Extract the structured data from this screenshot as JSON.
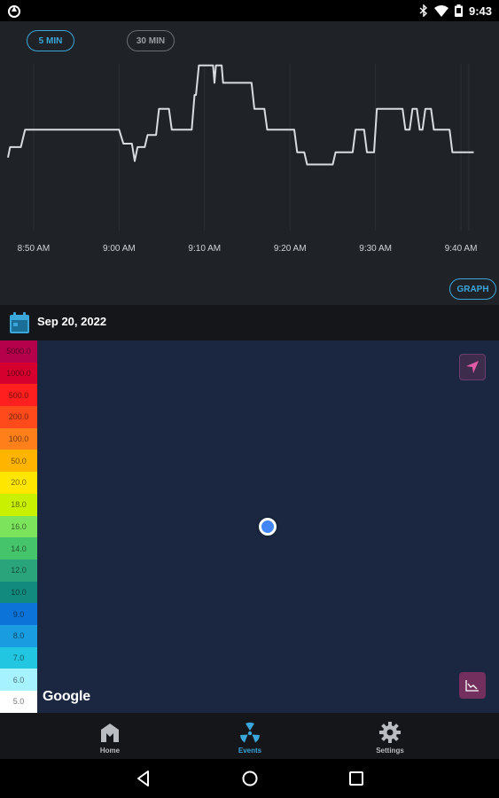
{
  "status_bar": {
    "time": "9:43"
  },
  "graph": {
    "range_buttons": [
      "5 MIN",
      "30 MIN"
    ],
    "graph_button": "GRAPH",
    "colors": {
      "active": "#3aa6d9",
      "line": "#d9dcdf",
      "grid": "#2c3036"
    }
  },
  "chart_data": {
    "type": "line",
    "x_ticks": [
      "8:50 AM",
      "9:00 AM",
      "9:10 AM",
      "9:20 AM",
      "9:30 AM",
      "9:40 AM"
    ],
    "x_range": [
      "8:47 AM",
      "9:43 AM"
    ],
    "grid": "vertical",
    "series": [
      {
        "values": [
          {
            "t": "8:47:00",
            "v": 0.42
          },
          {
            "t": "8:47:15",
            "v": 0.48
          },
          {
            "t": "8:48:30",
            "v": 0.48
          },
          {
            "t": "8:49:00",
            "v": 0.58
          },
          {
            "t": "9:00:00",
            "v": 0.58
          },
          {
            "t": "9:00:30",
            "v": 0.5
          },
          {
            "t": "9:01:30",
            "v": 0.5
          },
          {
            "t": "9:01:50",
            "v": 0.4
          },
          {
            "t": "9:02:10",
            "v": 0.48
          },
          {
            "t": "9:03:00",
            "v": 0.48
          },
          {
            "t": "9:03:20",
            "v": 0.55
          },
          {
            "t": "9:04:20",
            "v": 0.55
          },
          {
            "t": "9:04:40",
            "v": 0.7
          },
          {
            "t": "9:05:50",
            "v": 0.7
          },
          {
            "t": "9:06:10",
            "v": 0.58
          },
          {
            "t": "9:08:30",
            "v": 0.58
          },
          {
            "t": "9:08:50",
            "v": 0.78
          },
          {
            "t": "9:09:00",
            "v": 0.78
          },
          {
            "t": "9:09:20",
            "v": 0.95
          },
          {
            "t": "9:11:00",
            "v": 0.95
          },
          {
            "t": "9:11:10",
            "v": 0.85
          },
          {
            "t": "9:11:20",
            "v": 0.95
          },
          {
            "t": "9:12:00",
            "v": 0.95
          },
          {
            "t": "9:12:10",
            "v": 0.85
          },
          {
            "t": "9:15:30",
            "v": 0.85
          },
          {
            "t": "9:15:50",
            "v": 0.7
          },
          {
            "t": "9:17:00",
            "v": 0.7
          },
          {
            "t": "9:17:20",
            "v": 0.58
          },
          {
            "t": "9:20:30",
            "v": 0.58
          },
          {
            "t": "9:20:50",
            "v": 0.45
          },
          {
            "t": "9:21:40",
            "v": 0.45
          },
          {
            "t": "9:22:00",
            "v": 0.38
          },
          {
            "t": "9:25:00",
            "v": 0.38
          },
          {
            "t": "9:25:20",
            "v": 0.45
          },
          {
            "t": "9:27:20",
            "v": 0.45
          },
          {
            "t": "9:27:40",
            "v": 0.58
          },
          {
            "t": "9:28:40",
            "v": 0.58
          },
          {
            "t": "9:29:00",
            "v": 0.45
          },
          {
            "t": "9:29:50",
            "v": 0.45
          },
          {
            "t": "9:30:10",
            "v": 0.7
          },
          {
            "t": "9:33:10",
            "v": 0.7
          },
          {
            "t": "9:33:30",
            "v": 0.58
          },
          {
            "t": "9:34:00",
            "v": 0.58
          },
          {
            "t": "9:34:20",
            "v": 0.7
          },
          {
            "t": "9:34:50",
            "v": 0.7
          },
          {
            "t": "9:35:10",
            "v": 0.58
          },
          {
            "t": "9:35:30",
            "v": 0.58
          },
          {
            "t": "9:35:50",
            "v": 0.7
          },
          {
            "t": "9:36:30",
            "v": 0.7
          },
          {
            "t": "9:36:50",
            "v": 0.58
          },
          {
            "t": "9:38:40",
            "v": 0.58
          },
          {
            "t": "9:39:00",
            "v": 0.45
          },
          {
            "t": "9:41:30",
            "v": 0.45
          }
        ]
      }
    ]
  },
  "date_row": {
    "date": "Sep 20, 2022"
  },
  "map": {
    "attribution": "Google",
    "legend": [
      {
        "label": "5000.0",
        "color": "#b5004c"
      },
      {
        "label": "1000.0",
        "color": "#d6002f"
      },
      {
        "label": "500.0",
        "color": "#ff1f1f"
      },
      {
        "label": "200.0",
        "color": "#ff4a1c"
      },
      {
        "label": "100.0",
        "color": "#ff7f1a"
      },
      {
        "label": "50.0",
        "color": "#ffb400"
      },
      {
        "label": "20.0",
        "color": "#ffe600"
      },
      {
        "label": "18.0",
        "color": "#c8f000"
      },
      {
        "label": "16.0",
        "color": "#7ce35c"
      },
      {
        "label": "14.0",
        "color": "#45c46b"
      },
      {
        "label": "12.0",
        "color": "#2aa47a"
      },
      {
        "label": "10.0",
        "color": "#138a7e"
      },
      {
        "label": "9.0",
        "color": "#0c74d8"
      },
      {
        "label": "8.0",
        "color": "#1a9de0"
      },
      {
        "label": "7.0",
        "color": "#22c6e0"
      },
      {
        "label": "6.0",
        "color": "#a7f2ff"
      },
      {
        "label": "5.0",
        "color": "#ffffff"
      }
    ]
  },
  "tabs": [
    {
      "label": "Home",
      "icon": "home-icon",
      "active": false
    },
    {
      "label": "Events",
      "icon": "radiation-icon",
      "active": true
    },
    {
      "label": "Settings",
      "icon": "gear-icon",
      "active": false
    }
  ]
}
